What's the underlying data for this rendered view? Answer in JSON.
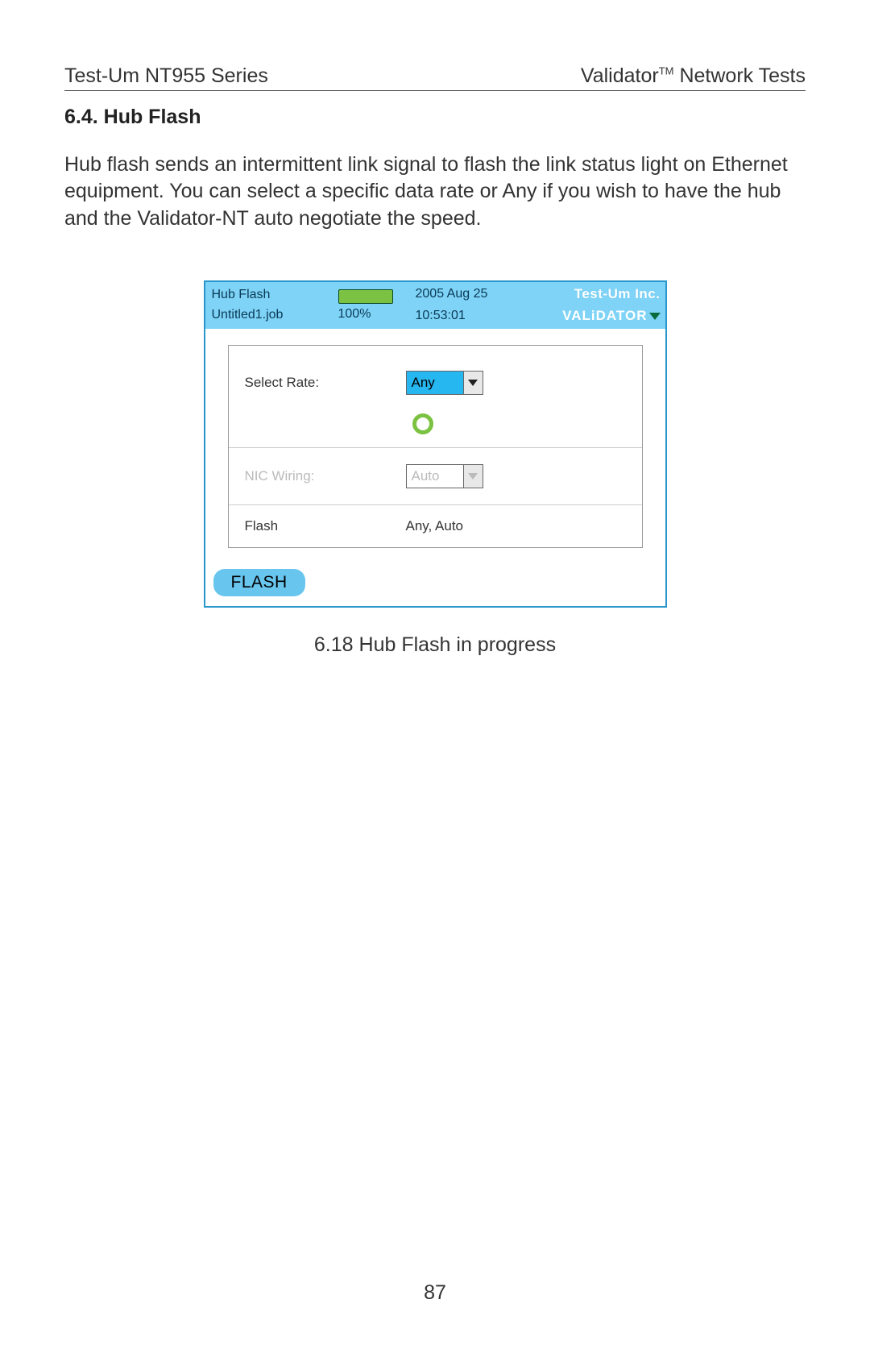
{
  "header": {
    "left": "Test-Um NT955 Series",
    "right_prefix": "Validator",
    "right_tm": "TM",
    "right_suffix": " Network Tests"
  },
  "section": {
    "number_title": "6.4. Hub Flash",
    "body": "Hub flash sends an intermittent link signal to flash the link status light on Ethernet equipment.  You can select a specific data rate or Any if you wish to have the hub and the Validator-NT auto negotiate the speed."
  },
  "device": {
    "title": "Hub Flash",
    "job": "Untitled1.job",
    "battery_pct": "100%",
    "date": "2005 Aug 25",
    "time": "10:53:01",
    "brand_top": "Test-Um Inc.",
    "brand_bottom": "VALiDATOR",
    "rows": {
      "select_rate": {
        "label": "Select Rate:",
        "value": "Any"
      },
      "nic_wiring": {
        "label": "NIC Wiring:",
        "value": "Auto"
      },
      "status": {
        "label": "Flash",
        "value": "Any, Auto"
      }
    },
    "button": "FLASH"
  },
  "caption": "6.18 Hub Flash in progress",
  "page_number": "87"
}
